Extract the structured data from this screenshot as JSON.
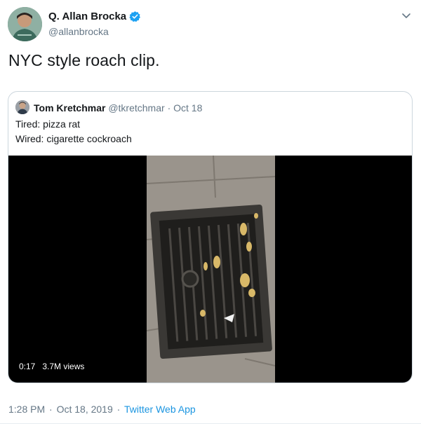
{
  "author": {
    "name": "Q. Allan Brocka",
    "handle": "@allanbrocka"
  },
  "tweet": {
    "text": "NYC style roach clip."
  },
  "quoted": {
    "name": "Tom Kretchmar",
    "handle": "@tkretchmar",
    "separator": "·",
    "date": "Oct 18",
    "lines": [
      "Tired: pizza rat",
      "Wired: cigarette cockroach"
    ]
  },
  "video": {
    "duration": "0:17",
    "views": "3.7M views"
  },
  "footer": {
    "time": "1:28 PM",
    "separator": "·",
    "date": "Oct 18, 2019",
    "separator2": "·",
    "app": "Twitter Web App"
  },
  "colors": {
    "verified": "#1da1f2",
    "link": "#1b95e0",
    "muted": "#657786",
    "border": "#ccd6dd"
  },
  "icons": {
    "verified": "verified-badge-icon",
    "more": "chevron-down-icon"
  }
}
